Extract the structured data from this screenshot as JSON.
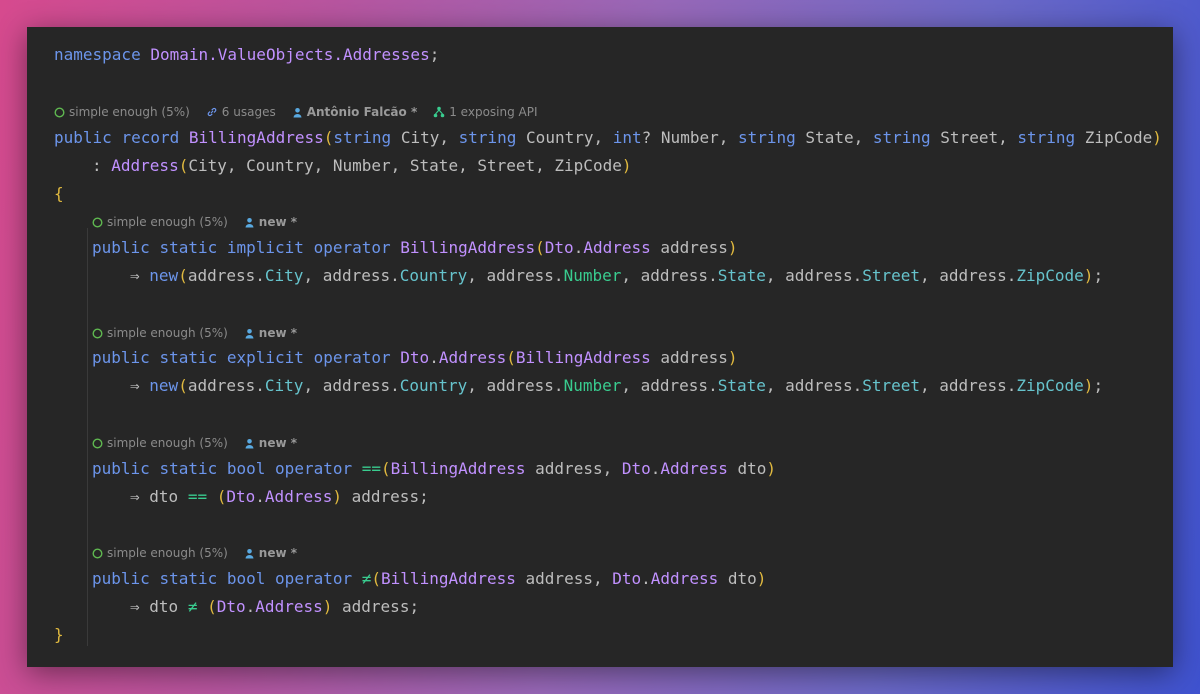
{
  "line_namespace": {
    "kw": "namespace",
    "name": "Domain.ValueObjects.Addresses",
    "end": ";"
  },
  "record_hints": {
    "complexity": "simple enough (5%)",
    "usages": "6 usages",
    "author": "Antônio Falcão *",
    "exposing": "1 exposing API"
  },
  "member_hints": {
    "complexity": "simple enough (5%)",
    "author": "new *"
  },
  "code": {
    "public": "public",
    "record": "record",
    "static": "static",
    "implicit": "implicit",
    "explicit": "explicit",
    "operator": "operator",
    "string": "string",
    "int": "int",
    "bool": "bool",
    "new": "new",
    "BillingAddress": "BillingAddress",
    "Address": "Address",
    "Dto": "Dto",
    "dto": "dto",
    "address": "address",
    "City": "City",
    "Country": "Country",
    "Number": "Number",
    "State": "State",
    "Street": "Street",
    "ZipCode": "ZipCode",
    "arrow": "⇒",
    "eq": "==",
    "neq": "≠",
    "lbrace": "{",
    "rbrace": "}"
  },
  "colors": {
    "background": "#262626",
    "keyword": "#6c95eb",
    "type": "#c191ff",
    "property": "#66c3cc",
    "bracket": "#e0b93f",
    "operator": "#39cc8f",
    "text": "#bdbdbd"
  }
}
